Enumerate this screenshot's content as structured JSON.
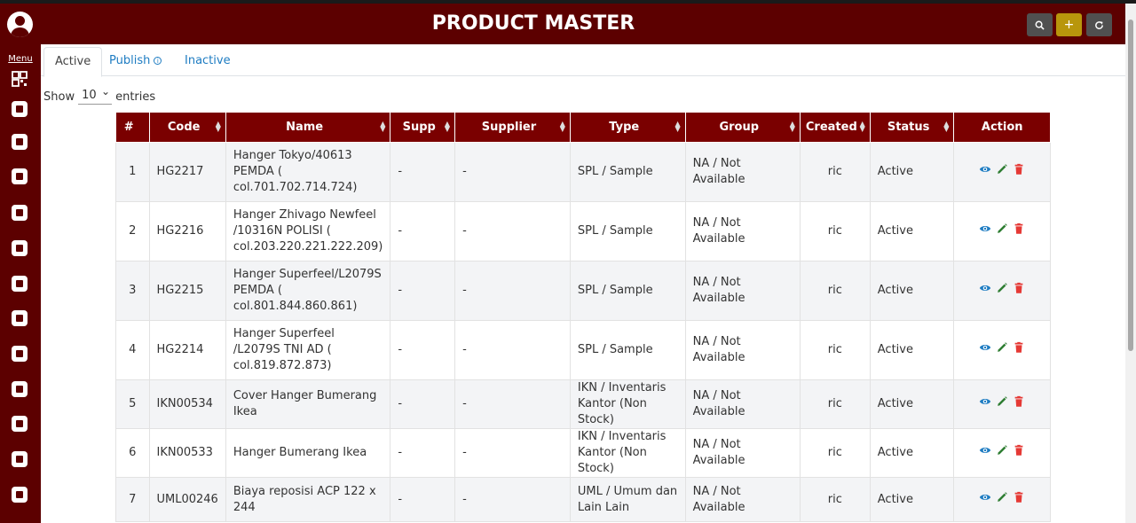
{
  "header": {
    "title": "PRODUCT MASTER",
    "search_icon": "search-icon",
    "add_label": "+",
    "refresh_icon": "refresh-icon"
  },
  "sidebar": {
    "menu_label": "Menu",
    "icons": [
      "dashboard-icon",
      "grid-icon",
      "cards-icon",
      "box-icon",
      "chart-icon",
      "money-icon",
      "factory-icon",
      "bank-icon",
      "cart-icon",
      "badge-icon",
      "person-icon",
      "wallet-icon",
      "users-icon"
    ]
  },
  "tabs": [
    {
      "label": "Active"
    },
    {
      "label": "Publish"
    },
    {
      "label": "Inactive"
    }
  ],
  "length": {
    "show": "Show",
    "value": "10",
    "entries": "entries"
  },
  "table": {
    "headers": [
      "#",
      "Code",
      "Name",
      "Supp",
      "Supplier",
      "Type",
      "Group",
      "Created",
      "Status",
      "Action"
    ],
    "rows": [
      {
        "n": "1",
        "code": "HG2217",
        "name": "Hanger Tokyo/40613 PEMDA ( col.701.702.714.724)",
        "supp": "-",
        "supplier": "-",
        "type": "SPL / Sample",
        "group": "NA / Not Available",
        "created": "ric",
        "status": "Active"
      },
      {
        "n": "2",
        "code": "HG2216",
        "name": "Hanger Zhivago Newfeel /10316N POLISI ( col.203.220.221.222.209)",
        "supp": "-",
        "supplier": "-",
        "type": "SPL / Sample",
        "group": "NA / Not Available",
        "created": "ric",
        "status": "Active"
      },
      {
        "n": "3",
        "code": "HG2215",
        "name": "Hanger Superfeel/L2079S PEMDA ( col.801.844.860.861)",
        "supp": "-",
        "supplier": "-",
        "type": "SPL / Sample",
        "group": "NA / Not Available",
        "created": "ric",
        "status": "Active"
      },
      {
        "n": "4",
        "code": "HG2214",
        "name": "Hanger Superfeel /L2079S TNI AD ( col.819.872.873)",
        "supp": "-",
        "supplier": "-",
        "type": "SPL / Sample",
        "group": "NA / Not Available",
        "created": "ric",
        "status": "Active"
      },
      {
        "n": "5",
        "code": "IKN00534",
        "name": "Cover Hanger Bumerang Ikea",
        "supp": "-",
        "supplier": "-",
        "type": "IKN / Inventaris Kantor (Non Stock)",
        "group": "NA / Not Available",
        "created": "ric",
        "status": "Active"
      },
      {
        "n": "6",
        "code": "IKN00533",
        "name": "Hanger Bumerang Ikea",
        "supp": "-",
        "supplier": "-",
        "type": "IKN / Inventaris Kantor (Non Stock)",
        "group": "NA / Not Available",
        "created": "ric",
        "status": "Active"
      },
      {
        "n": "7",
        "code": "UML00246",
        "name": "Biaya reposisi ACP 122 x 244",
        "supp": "-",
        "supplier": "-",
        "type": "UML / Umum dan Lain Lain",
        "group": "NA / Not Available",
        "created": "ric",
        "status": "Active"
      }
    ]
  },
  "colors": {
    "brand": "#5c0000",
    "table_header": "#7a0000",
    "add_button": "#b8960c",
    "link": "#1e7cc2",
    "view": "#1e7cc2",
    "edit": "#2e7d32",
    "delete": "#e53935"
  }
}
